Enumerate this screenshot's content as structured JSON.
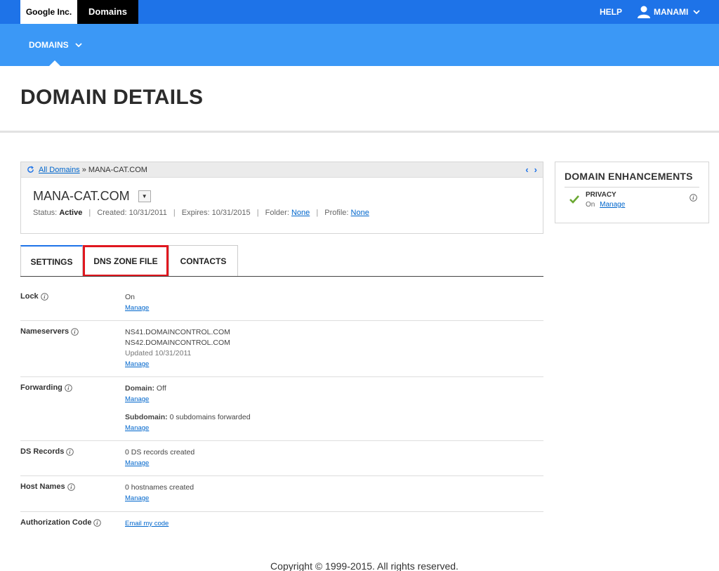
{
  "header": {
    "brand_company": "Google Inc.",
    "brand_product": "Domains",
    "help": "HELP",
    "user": "MANAMI"
  },
  "subnav": {
    "domains": "DOMAINS"
  },
  "page_title": "DOMAIN DETAILS",
  "domain_card": {
    "breadcrumb_link": "All Domains",
    "breadcrumb_sep": "»",
    "breadcrumb_current": "MANA-CAT.COM",
    "domain_name": "MANA-CAT.COM",
    "status_label": "Status:",
    "status_value": "Active",
    "created": "Created: 10/31/2011",
    "expires": "Expires: 10/31/2015",
    "folder_label": "Folder:",
    "folder_value": "None",
    "profile_label": "Profile:",
    "profile_value": "None",
    "separator": "|"
  },
  "enhancements": {
    "title": "DOMAIN ENHANCEMENTS",
    "items": [
      {
        "name": "PRIVACY",
        "state": "On",
        "link": "Manage"
      }
    ]
  },
  "tabs": [
    {
      "label": "SETTINGS"
    },
    {
      "label": "DNS ZONE FILE"
    },
    {
      "label": "CONTACTS"
    }
  ],
  "settings": {
    "lock": {
      "label": "Lock",
      "value": "On",
      "link": "Manage"
    },
    "nameservers": {
      "label": "Nameservers",
      "ns1": "NS41.DOMAINCONTROL.COM",
      "ns2": "NS42.DOMAINCONTROL.COM",
      "updated": "Updated 10/31/2011",
      "link": "Manage"
    },
    "forwarding": {
      "label": "Forwarding",
      "domain_label": "Domain:",
      "domain_value": "Off",
      "domain_link": "Manage",
      "subdomain_label": "Subdomain:",
      "subdomain_value": "0 subdomains forwarded",
      "subdomain_link": "Manage"
    },
    "ds_records": {
      "label": "DS Records",
      "value": "0 DS records created",
      "link": "Manage"
    },
    "host_names": {
      "label": "Host Names",
      "value": "0 hostnames created",
      "link": "Manage"
    },
    "auth_code": {
      "label": "Authorization Code",
      "link": "Email my code"
    }
  },
  "footer": "Copyright © 1999-2015. All rights reserved."
}
